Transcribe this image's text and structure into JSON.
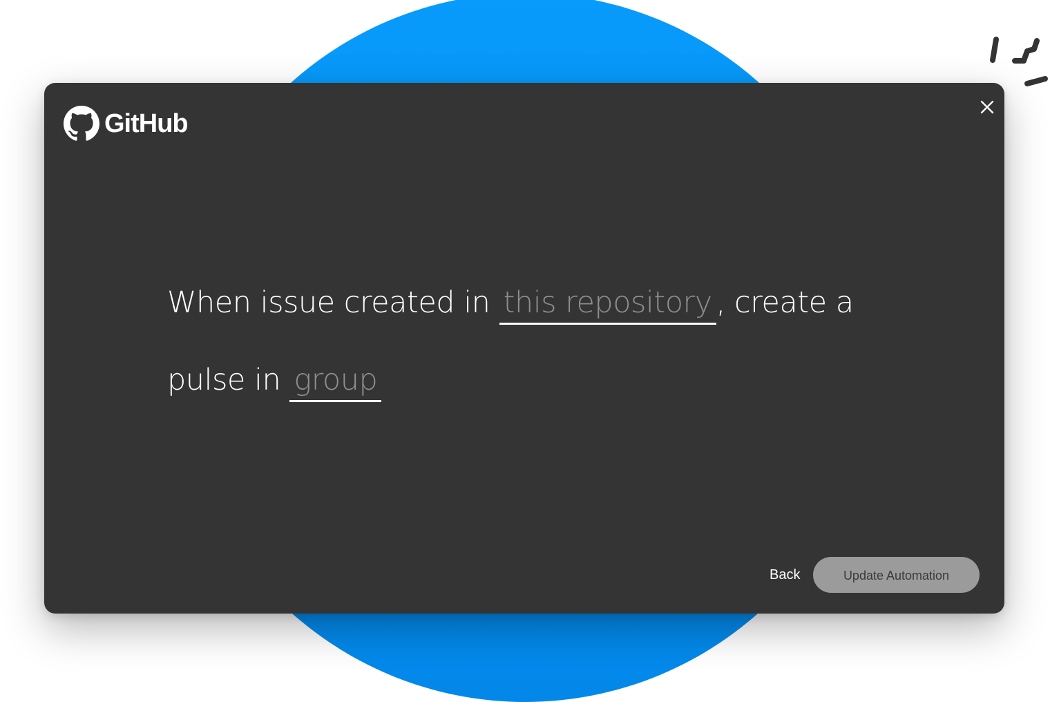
{
  "colors": {
    "accent_blue": "#079bfb",
    "modal_bg": "#343434",
    "placeholder_text": "#8f8f8f",
    "primary_button_bg": "#9b9b9b"
  },
  "modal": {
    "brand": {
      "name": "GitHub",
      "icon": "github-octocat-icon"
    },
    "close_icon": "close-icon",
    "sentence": {
      "part1": "When issue created in ",
      "repo_slot": "this repository",
      "part2": ", create a",
      "part3": "pulse in ",
      "group_slot": "group"
    },
    "footer": {
      "back_label": "Back",
      "update_label": "Update Automation"
    }
  }
}
